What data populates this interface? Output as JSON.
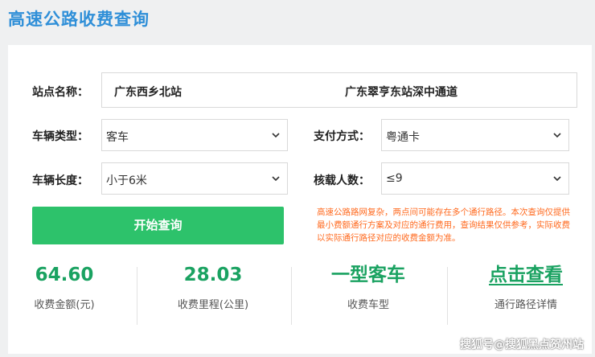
{
  "page": {
    "title": "高速公路收费查询"
  },
  "form": {
    "station_label": "站点名称：",
    "station_from": "广东西乡北站",
    "station_to": "广东翠亨东站深中通道",
    "vehicle_type_label": "车辆类型：",
    "vehicle_type_value": "客车",
    "payment_label": "支付方式：",
    "payment_value": "粤通卡",
    "vehicle_length_label": "车辆长度：",
    "vehicle_length_value": "小于6米",
    "passengers_label": "核载人数：",
    "passengers_value": "≤9",
    "query_button": "开始查询",
    "notice": "高速公路路网复杂，两点间可能存在多个通行路径。本次查询仅提供最小费额通行方案及对应的通行费用，查询结果仅供参考，实际收费以实际通行路径对应的收费金额为准。"
  },
  "results": {
    "fee_value": "64.60",
    "fee_label": "收费金额(元)",
    "distance_value": "28.03",
    "distance_label": "收费里程(公里)",
    "vehicle_class_value": "一型客车",
    "vehicle_class_label": "收费车型",
    "route_link": "点击查看",
    "route_label": "通行路径详情"
  },
  "watermark": "搜狐号@搜狐黑点贺州站",
  "colors": {
    "title": "#2f8fd8",
    "button": "#2dc26b",
    "result_value": "#1aa261",
    "notice": "#ff6a1f"
  }
}
